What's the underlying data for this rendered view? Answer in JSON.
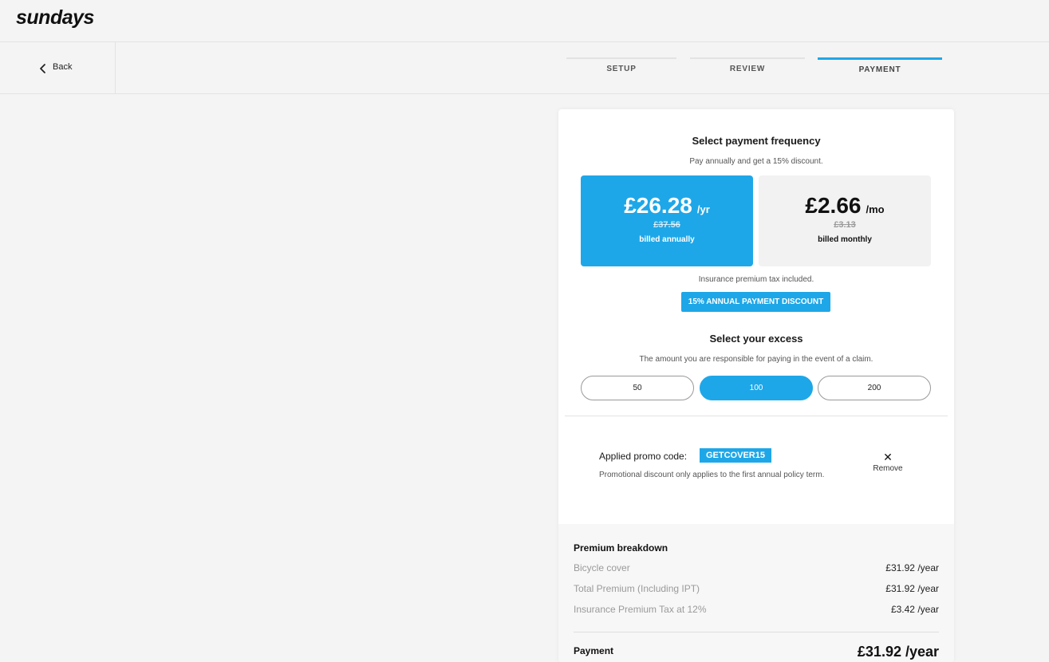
{
  "app": {
    "logo": "sundays"
  },
  "nav": {
    "back_label": "Back",
    "steps": [
      {
        "label": "SETUP",
        "active": false
      },
      {
        "label": "REVIEW",
        "active": false
      },
      {
        "label": "PAYMENT",
        "active": true
      }
    ]
  },
  "payment": {
    "title": "Select payment frequency",
    "subtitle": "Pay annually and get a 15% discount.",
    "annual": {
      "price": "£26.28",
      "per": "/yr",
      "old_price": "£37.56",
      "billed": "billed annually",
      "selected": true
    },
    "monthly": {
      "price": "£2.66",
      "per": "/mo",
      "old_price": "£3.13",
      "billed": "billed monthly",
      "selected": false
    },
    "tax_note": "Insurance premium tax included.",
    "discount_badge": "15% ANNUAL PAYMENT DISCOUNT"
  },
  "excess": {
    "title": "Select your excess",
    "subtitle": "The amount you are responsible for paying in the event of a claim.",
    "options": [
      "50",
      "100",
      "200"
    ],
    "selected": "100"
  },
  "promo": {
    "label": "Applied promo code:",
    "code": "GETCOVER15",
    "note": "Promotional discount only applies to the first annual policy term.",
    "remove_label": "Remove"
  },
  "breakdown": {
    "title": "Premium breakdown",
    "rows": [
      {
        "name": "Bicycle cover",
        "value": "£31.92 /year"
      },
      {
        "name": "Total Premium (Including IPT)",
        "value": "£31.92 /year"
      },
      {
        "name": "Insurance Premium Tax at 12%",
        "value": "£3.42 /year"
      }
    ],
    "payment_label": "Payment",
    "payment_total": "£31.92 /year"
  },
  "colors": {
    "accent": "#1ea7e8",
    "background": "#f4f4f4"
  }
}
